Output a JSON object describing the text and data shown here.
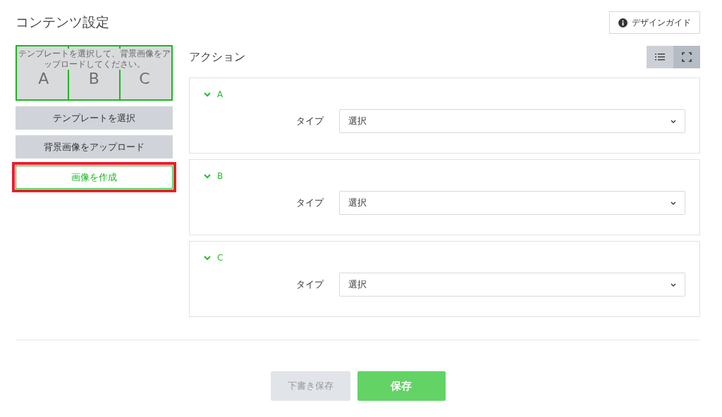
{
  "title": "コンテンツ設定",
  "design_guide_button": "デザインガイド",
  "preview": {
    "hint": "テンプレートを選択して、背景画像をアップロードしてください。",
    "areas": [
      "A",
      "B",
      "C"
    ]
  },
  "left_buttons": [
    {
      "label": "テンプレートを選択",
      "kind": "plain"
    },
    {
      "label": "背景画像をアップロード",
      "kind": "plain"
    },
    {
      "label": "画像を作成",
      "kind": "outline",
      "highlighted": true
    }
  ],
  "actions_title": "アクション",
  "view_toggle": [
    {
      "selected": false
    },
    {
      "selected": true
    }
  ],
  "actions": [
    {
      "name": "A",
      "expanded": true,
      "type_label": "タイプ",
      "select_value": "選択"
    },
    {
      "name": "B",
      "expanded": true,
      "type_label": "タイプ",
      "select_value": "選択"
    },
    {
      "name": "C",
      "expanded": true,
      "type_label": "タイプ",
      "select_value": "選択"
    }
  ],
  "footer_buttons": [
    {
      "label": "下書き保存",
      "kind": "secondary",
      "disabled": true
    },
    {
      "label": "保存",
      "kind": "primary",
      "disabled": false
    }
  ]
}
